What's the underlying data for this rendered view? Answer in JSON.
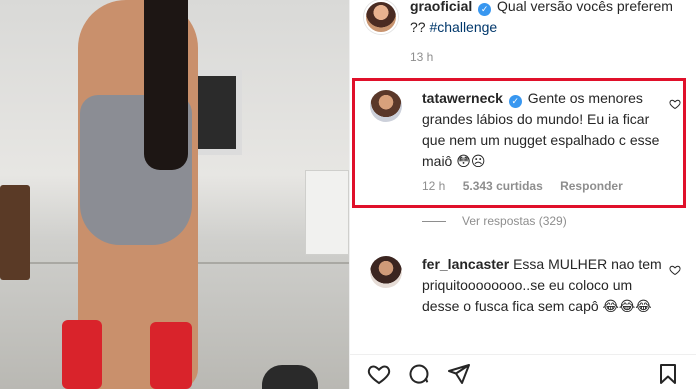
{
  "post": {
    "username": "graoficial",
    "caption": "Qual versão vocês preferem ?? ",
    "hashtag": "#challenge",
    "time": "13 h"
  },
  "comments": [
    {
      "username": "tatawerneck",
      "verified": true,
      "text": "Gente os menores grandes lábios do mundo! Eu ia ficar que nem um nugget espalhado c esse maiô 😳☹",
      "time": "12 h",
      "likes": "5.343 curtidas",
      "reply": "Responder"
    },
    {
      "username": "fer_lancaster",
      "verified": false,
      "text": "Essa MULHER nao tem priquitoooooooo..se eu coloco um desse o fusca fica sem capô 😂😂😂"
    }
  ],
  "view_replies": "Ver respostas (329)",
  "highlight_color": "#e0102a",
  "icons": [
    "heart-icon",
    "comment-icon",
    "share-icon",
    "bookmark-icon",
    "verified-icon",
    "like-comment-icon"
  ]
}
